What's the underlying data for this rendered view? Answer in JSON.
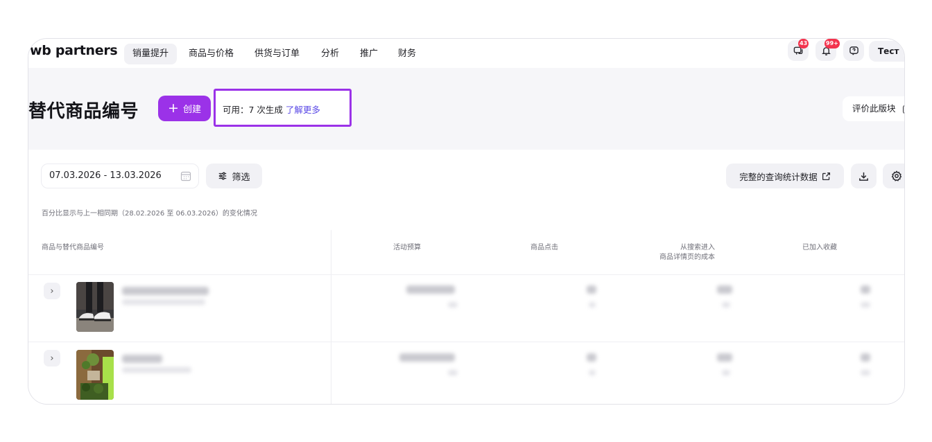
{
  "nav": {
    "logo": "wb partners",
    "items": [
      "销量提升",
      "商品与价格",
      "供货与订单",
      "分析",
      "推广",
      "财务"
    ],
    "active_index": 0,
    "chat_badge": "43",
    "notif_badge": "99+",
    "user_label": "Тест"
  },
  "header": {
    "title": "替代商品编号",
    "create_label": "创建",
    "available_text": "可用：7 次生成",
    "learn_more": "了解更多",
    "rate_label": "评价此版块"
  },
  "toolbar": {
    "date_range": "07.03.2026 - 13.03.2026",
    "filter_label": "筛选",
    "stats_label": "完整的查询统计数据"
  },
  "note": "百分比显示与上一相同期（28.02.2026 至 06.03.2026）的变化情况",
  "table": {
    "columns": [
      "商品与替代商品编号",
      "活动预算",
      "商品点击",
      "从搜索进入",
      "商品详情页的成本",
      "已加入收藏"
    ]
  },
  "colors": {
    "accent": "#9b32e8",
    "link": "#5a49e6",
    "badge": "#f3344e"
  }
}
